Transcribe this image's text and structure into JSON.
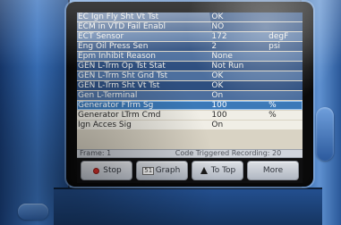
{
  "parameters": [
    {
      "name": "EC Ign Fly Sht Vt Tst",
      "value": "OK",
      "unit": ""
    },
    {
      "name": "ECM in VTD Fail Enabl",
      "value": "NO",
      "unit": ""
    },
    {
      "name": "ECT Sensor",
      "value": "172",
      "unit": "degF"
    },
    {
      "name": "Eng Oil Press Sen",
      "value": "2",
      "unit": "psi"
    },
    {
      "name": "Epm Inhibit Reason",
      "value": "None",
      "unit": ""
    },
    {
      "name": "GEN L-Trm Op Tst Stat",
      "value": "Not Run",
      "unit": ""
    },
    {
      "name": "GEN L-Trm Sht Gnd Tst",
      "value": "OK",
      "unit": ""
    },
    {
      "name": "GEN L-Trm Sht Vt Tst",
      "value": "OK",
      "unit": ""
    },
    {
      "name": "Gen L-Terminal",
      "value": "On",
      "unit": ""
    },
    {
      "name": "Generator FTrm Sg",
      "value": "100",
      "unit": "%"
    },
    {
      "name": "Generator LTrm Cmd",
      "value": "100",
      "unit": "%"
    },
    {
      "name": "Ign Acces Sig",
      "value": "On",
      "unit": ""
    }
  ],
  "status": {
    "frame": "Frame: 1",
    "recording": "Code Triggered Recording: 20"
  },
  "softkeys": {
    "stop": "Stop",
    "graph": "Graph",
    "to_top": "To Top",
    "more": "More"
  },
  "icons": {
    "stop": "stop-icon",
    "graph": "graph-icon",
    "to_top": "up-arrow-icon"
  },
  "colors": {
    "row_dark": "#2e4f80",
    "row_mid": "#4d6f9e",
    "row_selected": "#3b79b8",
    "screen_bg": "#d8d3c4",
    "stop_red": "#d5312b"
  }
}
